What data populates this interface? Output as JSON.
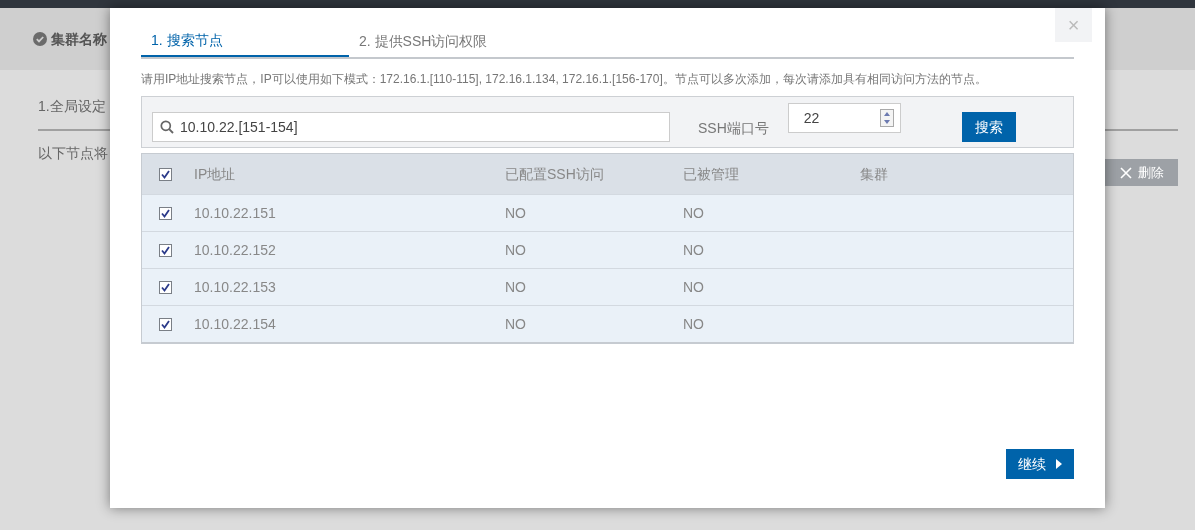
{
  "background": {
    "header_title": "集群名称",
    "section_title": "1.全局设定",
    "note": "以下节点将",
    "delete_button": "删除"
  },
  "dialog": {
    "close": "×",
    "tabs": [
      {
        "label": "1. 搜索节点",
        "selected": true
      },
      {
        "label": "2. 提供SSH访问权限",
        "selected": false
      }
    ],
    "hint": "请用IP地址搜索节点，IP可以使用如下模式：172.16.1.[110-115], 172.16.1.134, 172.16.1.[156-170]。节点可以多次添加，每次请添加具有相同访问方法的节点。",
    "search": {
      "value": "10.10.22.[151-154]"
    },
    "port": {
      "label": "SSH端口号",
      "value": "22"
    },
    "search_button": "搜索",
    "table": {
      "select_all": true,
      "columns": [
        "IP地址",
        "已配置SSH访问",
        "已被管理",
        "集群"
      ],
      "rows": [
        {
          "checked": true,
          "ip": "10.10.22.151",
          "ssh": "NO",
          "managed": "NO"
        },
        {
          "checked": true,
          "ip": "10.10.22.152",
          "ssh": "NO",
          "managed": "NO"
        },
        {
          "checked": true,
          "ip": "10.10.22.153",
          "ssh": "NO",
          "managed": "NO"
        },
        {
          "checked": true,
          "ip": "10.10.22.154",
          "ssh": "NO",
          "managed": "NO"
        }
      ]
    },
    "continue_button": "继续"
  }
}
